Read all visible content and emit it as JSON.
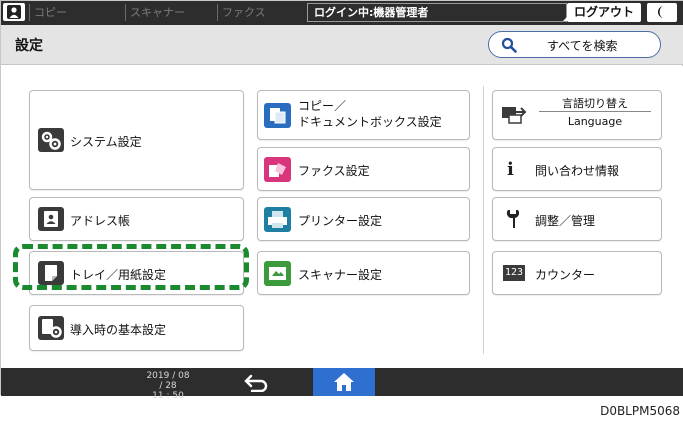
{
  "topbar": {
    "tabs": [
      "コピー",
      "スキャナー",
      "ファクス"
    ],
    "login_status": "ログイン中:機器管理者",
    "logout_label": "ログアウト"
  },
  "header": {
    "title": "設定",
    "search_all_label": "すべてを検索"
  },
  "tiles": {
    "system": "システム設定",
    "address_book": "アドレス帳",
    "tray_paper": "トレイ／用紙設定",
    "initial_setup": "導入時の基本設定",
    "copy_docbox_line1": "コピー／",
    "copy_docbox_line2": "ドキュメントボックス設定",
    "fax": "ファクス設定",
    "printer": "プリンター設定",
    "scanner": "スキャナー設定",
    "lang_top": "言語切り替え",
    "lang_bottom": "Language",
    "inquiry": "問い合わせ情報",
    "adjust_manage": "調整／管理",
    "counter": "カウンター",
    "counter_icon_text": "123",
    "info_icon_text": "i"
  },
  "bottombar": {
    "date": "2019 / 08 / 28",
    "time": "11 : 50"
  },
  "doc_id": "D0BLPM5068",
  "colors": {
    "highlight": "#1a8a2e",
    "home_button": "#2f6fcf",
    "bar": "#2d2d2d"
  },
  "icons": {
    "user": "user-icon",
    "moon": "moon-icon",
    "search": "search-icon",
    "back": "back-arrow-icon",
    "home": "home-icon"
  }
}
